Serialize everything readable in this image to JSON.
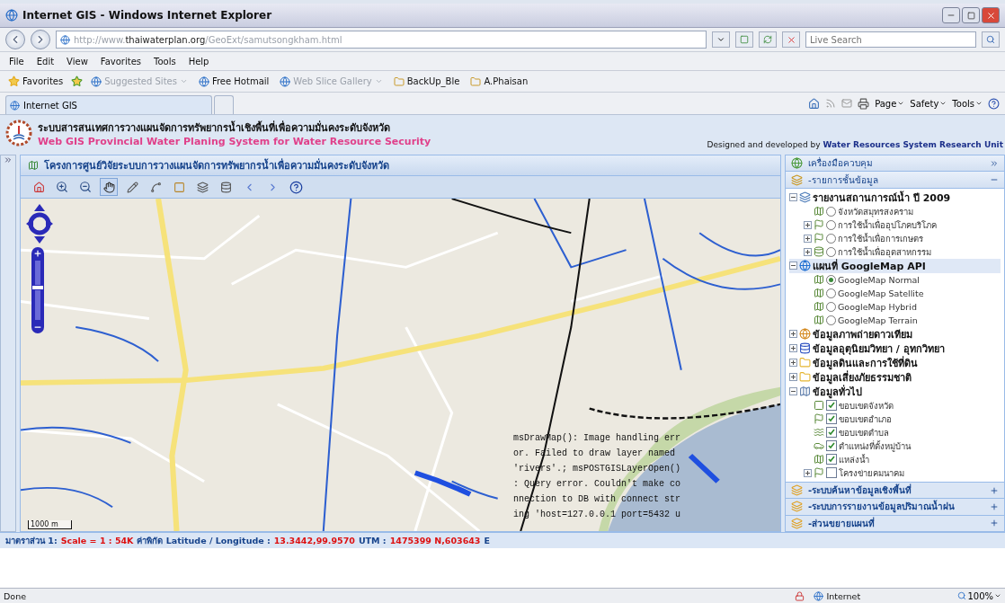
{
  "window": {
    "title": "Internet GIS - Windows Internet Explorer"
  },
  "address": {
    "prefix": "http://www.",
    "domain": "thaiwaterplan.org",
    "path": "/GeoExt/samutsongkham.html"
  },
  "search": {
    "placeholder": "Live Search"
  },
  "menu": [
    "File",
    "Edit",
    "View",
    "Favorites",
    "Tools",
    "Help"
  ],
  "favorites_bar": {
    "label": "Favorites",
    "items": [
      {
        "kind": "page",
        "label": "Suggested Sites",
        "disabled": true,
        "dropdown": true
      },
      {
        "kind": "page",
        "label": "Free Hotmail",
        "disabled": false,
        "dropdown": false
      },
      {
        "kind": "page",
        "label": "Web Slice Gallery",
        "disabled": true,
        "dropdown": true
      },
      {
        "kind": "folder",
        "label": "BackUp_Ble",
        "disabled": false,
        "dropdown": false
      },
      {
        "kind": "folder",
        "label": "A.Phaisan",
        "disabled": false,
        "dropdown": false
      }
    ]
  },
  "tabs": [
    {
      "label": "Internet GIS",
      "selected": true
    }
  ],
  "command_bar": [
    "Page",
    "Safety",
    "Tools"
  ],
  "header": {
    "title_th": "ระบบสารสนเทศการวางแผนจัดการทรัพยากรน้ำเชิงพื้นที่เพื่อความมั่นคงระดับจังหวัด",
    "title_en": "Web GIS Provincial Water Planing System for Water Resource Security",
    "credit": "Designed and developed by",
    "credit_org": "Water Resources System Research Unit"
  },
  "map_panel": {
    "zoom_slider": {
      "level": 0.55
    },
    "title": "โครงการศูนย์วิจัยระบบการวางแผนจัดการทรัพยากรน้ำเพื่อความมั่นคงระดับจังหวัด",
    "scale_label": "1000 m",
    "error_lines": [
      "msDrawMap(): Image handling err",
      "or. Failed to draw layer named",
      "'rivers'.; msPOSTGISLayerOpen()",
      ": Query error. Couldn't make co",
      "nnection to DB with connect str",
      "ing 'host=127.0.0.1 port=5432 u"
    ]
  },
  "control_panel": {
    "title": "เครื่องมือควบคุม",
    "layers_title": "-รายการชั้นข้อมูล",
    "tree": [
      {
        "label": "รายงานสถานการณ์น้ำ ปี 2009",
        "expanded": true,
        "selected": false,
        "children": [
          {
            "kind": "radio",
            "label": "จังหวัดสมุทรสงคราม",
            "selected": false
          },
          {
            "kind": "radio",
            "label": "การใช้น้ำเพื่ออุปโภคบริโภค",
            "selected": false,
            "expanded": false
          },
          {
            "kind": "radio",
            "label": "การใช้น้ำเพื่อการเกษตร",
            "selected": false,
            "expanded": false
          },
          {
            "kind": "radio",
            "label": "การใช้น้ำเพื่ออุตสาหกรรม",
            "selected": false,
            "expanded": false
          }
        ]
      },
      {
        "label": "แผนที่ GoogleMap API",
        "expanded": true,
        "selected": true,
        "children": [
          {
            "kind": "radio",
            "label": "GoogleMap Normal",
            "selected": true
          },
          {
            "kind": "radio",
            "label": "GoogleMap Satellite",
            "selected": false
          },
          {
            "kind": "radio",
            "label": "GoogleMap Hybrid",
            "selected": false
          },
          {
            "kind": "radio",
            "label": "GoogleMap Terrain",
            "selected": false
          }
        ]
      },
      {
        "label": "ข้อมูลภาพถ่ายดาวเทียม",
        "expanded": false,
        "selected": false
      },
      {
        "label": "ข้อมูลอุตุนิยมวิทยา / อุทกวิทยา",
        "expanded": false,
        "selected": false
      },
      {
        "label": "ข้อมูลดินและการใช้ที่ดิน",
        "expanded": false,
        "selected": false
      },
      {
        "label": "ข้อมูลเสี่ยงภัยธรรมชาติ",
        "expanded": false,
        "selected": false
      },
      {
        "label": "ข้อมูลทั่วไป",
        "expanded": true,
        "selected": false,
        "children": [
          {
            "kind": "checkbox",
            "label": "ขอบเขตจังหวัด",
            "checked": true
          },
          {
            "kind": "checkbox",
            "label": "ขอบเขตอำเภอ",
            "checked": true
          },
          {
            "kind": "checkbox",
            "label": "ขอบเขตตำบล",
            "checked": true
          },
          {
            "kind": "checkbox",
            "label": "ตำแหน่งที่ตั้งหมู่บ้าน",
            "checked": true
          },
          {
            "kind": "checkbox",
            "label": "แหล่งน้ำ",
            "checked": true
          },
          {
            "kind": "checkbox",
            "label": "โครงข่ายคมนาคม",
            "checked": false,
            "expanded": false
          }
        ]
      }
    ],
    "sections": [
      "-ระบบค้นหาข้อมูลเชิงพื้นที่",
      "-ระบบการรายงานข้อมูลปริมาณน้ำฝน",
      "-ส่วนขยายแผนที่"
    ]
  },
  "coordinates": [
    {
      "kind": "label",
      "text": "มาตราส่วน 1:"
    },
    {
      "kind": "value",
      "text": "Scale = 1 : 54K"
    },
    {
      "kind": "label",
      "text": "ค่าพิกัด Latitude / Longitude :"
    },
    {
      "kind": "value",
      "text": "13.3442,99.9570"
    },
    {
      "kind": "label",
      "text": "UTM :"
    },
    {
      "kind": "value",
      "text": "1475399 N,603643"
    },
    {
      "kind": "label",
      "text": "E"
    }
  ],
  "status_bar": {
    "text": "Done",
    "zone": "Internet",
    "zoom": "100%"
  }
}
